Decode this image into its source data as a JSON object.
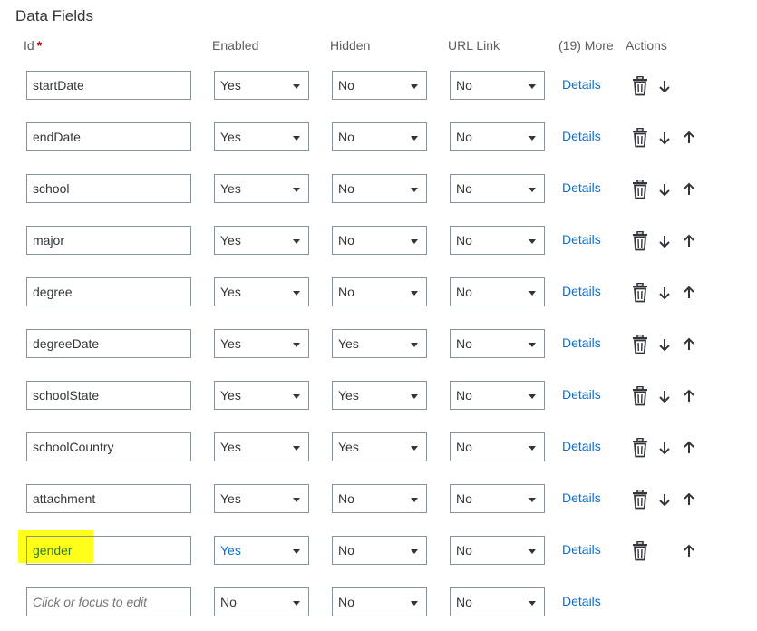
{
  "section_title": "Data Fields",
  "headers": {
    "id": "Id",
    "required_mark": "*",
    "enabled": "Enabled",
    "hidden": "Hidden",
    "url_link": "URL Link",
    "more": "(19) More",
    "actions": "Actions"
  },
  "details_label": "Details",
  "rows": [
    {
      "id": "startDate",
      "enabled": "Yes",
      "hidden": "No",
      "url_link": "No"
    },
    {
      "id": "endDate",
      "enabled": "Yes",
      "hidden": "No",
      "url_link": "No"
    },
    {
      "id": "school",
      "enabled": "Yes",
      "hidden": "No",
      "url_link": "No"
    },
    {
      "id": "major",
      "enabled": "Yes",
      "hidden": "No",
      "url_link": "No"
    },
    {
      "id": "degree",
      "enabled": "Yes",
      "hidden": "No",
      "url_link": "No"
    },
    {
      "id": "degreeDate",
      "enabled": "Yes",
      "hidden": "Yes",
      "url_link": "No"
    },
    {
      "id": "schoolState",
      "enabled": "Yes",
      "hidden": "Yes",
      "url_link": "No"
    },
    {
      "id": "schoolCountry",
      "enabled": "Yes",
      "hidden": "Yes",
      "url_link": "No"
    },
    {
      "id": "attachment",
      "enabled": "Yes",
      "hidden": "No",
      "url_link": "No"
    },
    {
      "id": "gender",
      "enabled": "Yes",
      "hidden": "No",
      "url_link": "No",
      "highlighted": true
    }
  ],
  "new_row": {
    "placeholder": "Click or focus to edit",
    "enabled": "No",
    "hidden": "No",
    "url_link": "No"
  },
  "icons": {
    "delete": "trash-icon",
    "move_down": "arrow-down-icon",
    "move_up": "arrow-up-icon",
    "dropdown": "caret-down-icon"
  },
  "colors": {
    "link": "#0a6ed1",
    "highlight": "#ffff1a",
    "required": "#bb0000",
    "border": "#89919a"
  }
}
